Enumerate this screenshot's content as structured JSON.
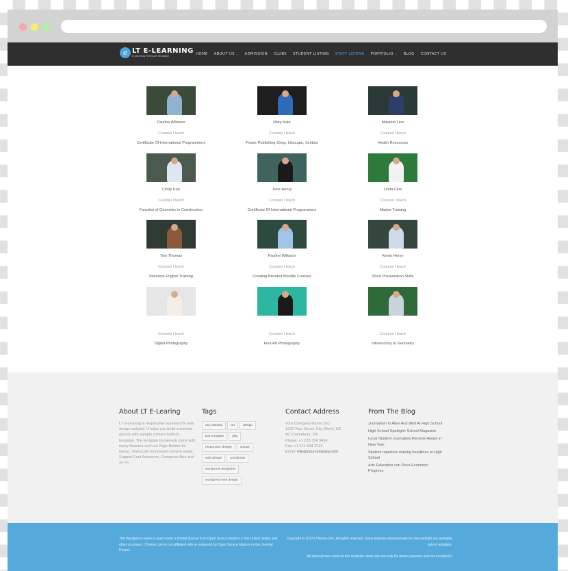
{
  "browser": {
    "controls": [
      "close",
      "minimize",
      "maximize"
    ],
    "url": ""
  },
  "site": {
    "logo_title": "LT E-LEARNING",
    "logo_subtitle": "E-Learning Premium Template",
    "logo_icon": "e-learning-logo-icon",
    "menu": [
      {
        "label": "HOME",
        "active": false,
        "dropdown": false
      },
      {
        "label": "ABOUT US",
        "active": false,
        "dropdown": true
      },
      {
        "label": "ADMISSION",
        "active": false,
        "dropdown": false
      },
      {
        "label": "CLUBS",
        "active": false,
        "dropdown": false
      },
      {
        "label": "STUDENT LISTING",
        "active": false,
        "dropdown": false
      },
      {
        "label": "STAFF LISTING",
        "active": true,
        "dropdown": false
      },
      {
        "label": "PORTFOLIO",
        "active": false,
        "dropdown": true
      },
      {
        "label": "BLOG",
        "active": false,
        "dropdown": false
      },
      {
        "label": "CONTACT US",
        "active": false,
        "dropdown": false
      }
    ],
    "accent_color": "#4ea3d9"
  },
  "staff": [
    {
      "name": "Pauline Wilkison",
      "courses_label": "Courses I teach",
      "course": "Certificate Of International Programmers",
      "photo": "teacher-at-laptop"
    },
    {
      "name": "Mary Kate",
      "courses_label": "Courses I teach",
      "course": "Power Publishing Gimp, Inkscape, Scribus",
      "photo": "teacher-impossible-chalkboard"
    },
    {
      "name": "Maranto Line",
      "courses_label": "Courses I teach",
      "course": "Health Resources",
      "photo": "teacher-math-chalkboard"
    },
    {
      "name": "Cindy Kan",
      "courses_label": "Courses I teach",
      "course": "Function of Geometry in Construction",
      "photo": "teacher-with-pointer"
    },
    {
      "name": "Jone Henry",
      "courses_label": "Courses I teach",
      "course": "Certificate Of International Programmers",
      "photo": "teacher-diagram-board"
    },
    {
      "name": "Linda Cine",
      "courses_label": "Courses I teach",
      "course": "Master Training",
      "photo": "teacher-arms-crossed"
    },
    {
      "name": "Tom Thomas",
      "courses_label": "Courses I teach",
      "course": "Intensive English Training",
      "photo": "teacher-writing-board"
    },
    {
      "name": "Pauline Wilkison",
      "courses_label": "Courses I teach",
      "course": "Creating Blended Moodle Courses",
      "photo": "teacher-presenting"
    },
    {
      "name": "Kento Henry",
      "courses_label": "Courses I teach",
      "course": "Short Presentation Skills",
      "photo": "teacher-with-glasses"
    },
    {
      "name": "",
      "courses_label": "Courses I teach",
      "course": "Digital Photography",
      "photo": "teacher-writing-whiteboard"
    },
    {
      "name": "",
      "courses_label": "Courses I teach",
      "course": "Fine Art Photography",
      "photo": "teacher-smiling-board"
    },
    {
      "name": "",
      "courses_label": "Courses I teach",
      "course": "Introductory to Geometry",
      "photo": "teacher-with-student"
    }
  ],
  "footer": {
    "about": {
      "title": "About LT E-Learing",
      "text": "LT E-Learing is responsive business for web design website. It helps you build a website quickly with sample content build-in template. The template framework come with many features such as Page Builder for layout, Shortcode for present content easily, Support Font Awesome, Compress files and so on."
    },
    "tags": {
      "title": "Tags",
      "items": [
        "any website",
        "art",
        "design",
        "last template",
        "php",
        "responsive design",
        "unique",
        "web design",
        "wordpress",
        "wordpress templates",
        "wordpress web design"
      ]
    },
    "contact": {
      "title": "Contact Address",
      "company": "Your Company Name JSC",
      "street": "1332 Your Street, City World, US",
      "city": "49 Chameleon, CA",
      "phone": "Phone: +1 223 334 3434",
      "fax": "Fax: +1 221 534 3222",
      "email_label": "Email: ",
      "email": "info@yourcompany.com"
    },
    "blog": {
      "title": "From The Blog",
      "items": [
        "Journalism Is Alive And Well At High School",
        "High School Spotlight: School Magazine",
        "Local Student Journalists Receive Award in New York",
        "Student reporters making headlines at High School",
        "Arts Education can Drive Economic Progress"
      ]
    }
  },
  "bottom_bar": {
    "license_text": "The Wordpress name is used under a limited license from Open Source Matters in the United States and other countries. LTheme.com is not affiliated with or endorsed by Open Source Matters or the Joomla! Project.",
    "copyright_text": "Copyright © 2013 LTheme.com. All rights reserved. Many features demonstrated on this website are available only in template.",
    "photos_text": "All stock photos used on this template demo site are only for demo purposes and not included in",
    "background_color": "#55aadb"
  }
}
